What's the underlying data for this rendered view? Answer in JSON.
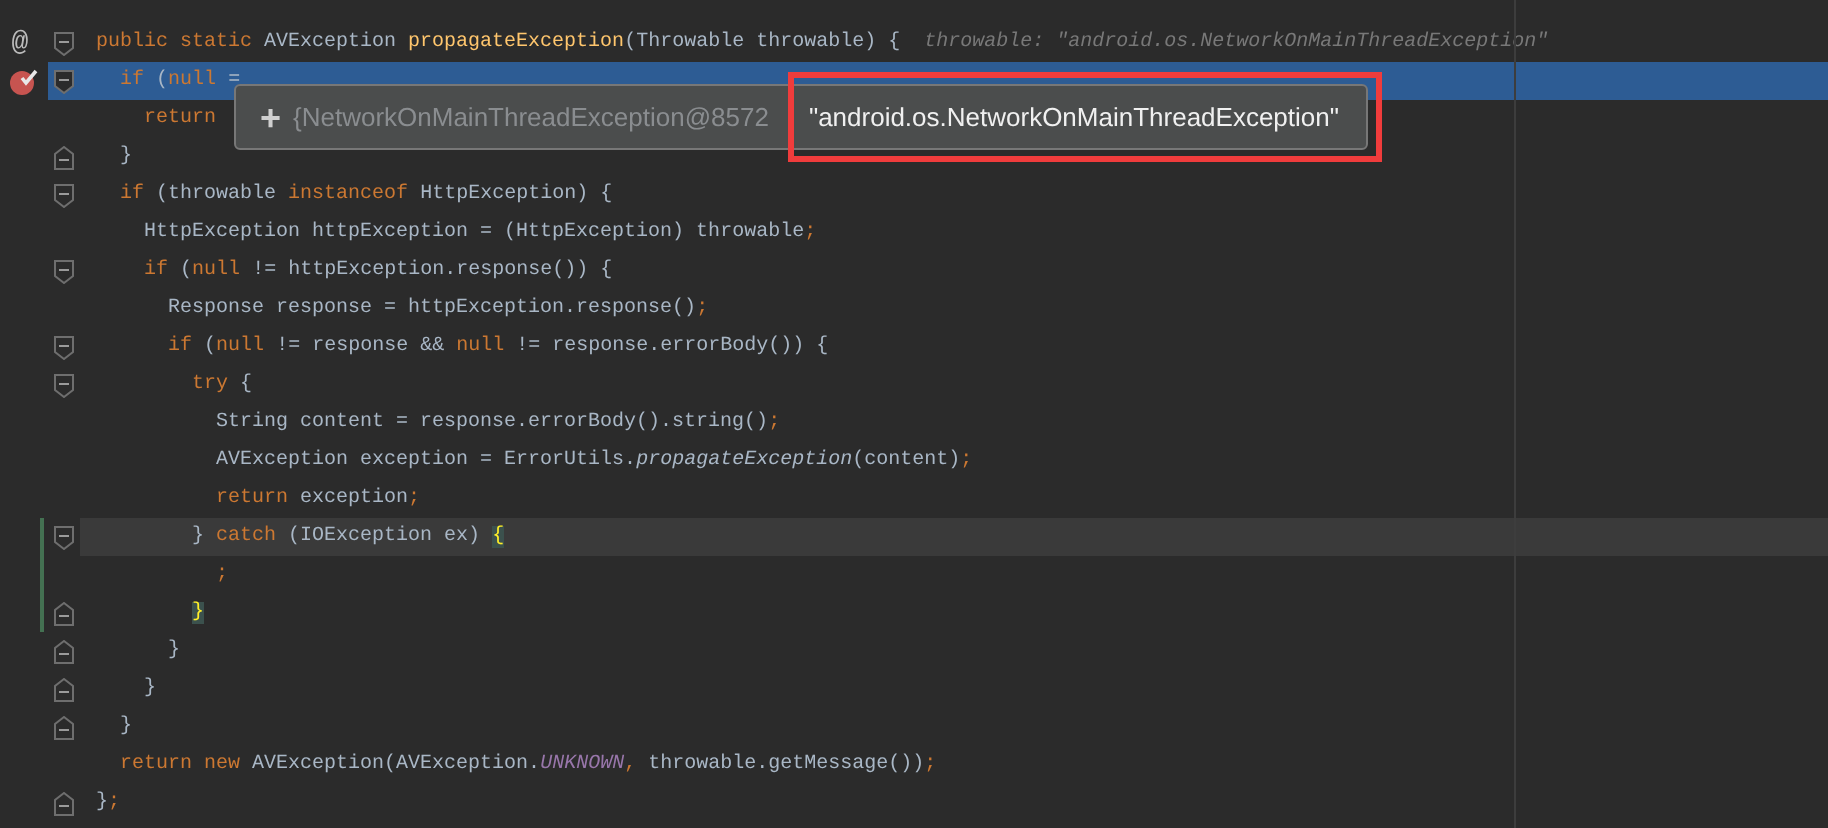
{
  "editor": {
    "lines": [
      {
        "gutter_mark": "@",
        "breakpoint": false,
        "fold_start": true,
        "fold_end": false,
        "highlighted": false,
        "caret_line": false,
        "changed": false,
        "segments": [
          {
            "kind": "keyword",
            "text": "public static "
          },
          {
            "kind": "plain",
            "text": "AVException "
          },
          {
            "kind": "method",
            "text": "propagateException"
          },
          {
            "kind": "plain",
            "text": "(Throwable throwable) {  "
          },
          {
            "kind": "hint",
            "text": "throwable: \"android.os.NetworkOnMainThreadException\""
          }
        ]
      },
      {
        "breakpoint": true,
        "fold_start": true,
        "fold_end": false,
        "highlighted": true,
        "caret_line": false,
        "changed": false,
        "segments": [
          {
            "kind": "keyword",
            "text": "  if "
          },
          {
            "kind": "plain",
            "text": "("
          },
          {
            "kind": "keyword",
            "text": "null"
          },
          {
            "kind": "plain",
            "text": " ="
          }
        ]
      },
      {
        "breakpoint": false,
        "fold_start": false,
        "fold_end": false,
        "highlighted": false,
        "caret_line": false,
        "changed": false,
        "segments": [
          {
            "kind": "keyword",
            "text": "    return"
          }
        ]
      },
      {
        "breakpoint": false,
        "fold_start": false,
        "fold_end": true,
        "highlighted": false,
        "caret_line": false,
        "changed": false,
        "segments": [
          {
            "kind": "plain",
            "text": "  }"
          }
        ]
      },
      {
        "breakpoint": false,
        "fold_start": true,
        "fold_end": false,
        "highlighted": false,
        "caret_line": false,
        "changed": false,
        "segments": [
          {
            "kind": "keyword",
            "text": "  if "
          },
          {
            "kind": "plain",
            "text": "(throwable "
          },
          {
            "kind": "keyword",
            "text": "instanceof "
          },
          {
            "kind": "plain",
            "text": "HttpException) {"
          }
        ]
      },
      {
        "breakpoint": false,
        "fold_start": false,
        "fold_end": false,
        "highlighted": false,
        "caret_line": false,
        "changed": false,
        "segments": [
          {
            "kind": "plain",
            "text": "    HttpException httpException = (HttpException) throwable"
          },
          {
            "kind": "keyword",
            "text": ";"
          }
        ]
      },
      {
        "breakpoint": false,
        "fold_start": true,
        "fold_end": false,
        "highlighted": false,
        "caret_line": false,
        "changed": false,
        "segments": [
          {
            "kind": "keyword",
            "text": "    if "
          },
          {
            "kind": "plain",
            "text": "("
          },
          {
            "kind": "keyword",
            "text": "null "
          },
          {
            "kind": "plain",
            "text": "!= httpException.response()) {"
          }
        ]
      },
      {
        "breakpoint": false,
        "fold_start": false,
        "fold_end": false,
        "highlighted": false,
        "caret_line": false,
        "changed": false,
        "segments": [
          {
            "kind": "plain",
            "text": "      Response response = httpException.response()"
          },
          {
            "kind": "keyword",
            "text": ";"
          }
        ]
      },
      {
        "breakpoint": false,
        "fold_start": true,
        "fold_end": false,
        "highlighted": false,
        "caret_line": false,
        "changed": false,
        "segments": [
          {
            "kind": "keyword",
            "text": "      if "
          },
          {
            "kind": "plain",
            "text": "("
          },
          {
            "kind": "keyword",
            "text": "null "
          },
          {
            "kind": "plain",
            "text": "!= response && "
          },
          {
            "kind": "keyword",
            "text": "null "
          },
          {
            "kind": "plain",
            "text": "!= response.errorBody()) {"
          }
        ]
      },
      {
        "breakpoint": false,
        "fold_start": true,
        "fold_end": false,
        "highlighted": false,
        "caret_line": false,
        "changed": false,
        "segments": [
          {
            "kind": "keyword",
            "text": "        try "
          },
          {
            "kind": "plain",
            "text": "{"
          }
        ]
      },
      {
        "breakpoint": false,
        "fold_start": false,
        "fold_end": false,
        "highlighted": false,
        "caret_line": false,
        "changed": false,
        "segments": [
          {
            "kind": "plain",
            "text": "          String content = response.errorBody().string()"
          },
          {
            "kind": "keyword",
            "text": ";"
          }
        ]
      },
      {
        "breakpoint": false,
        "fold_start": false,
        "fold_end": false,
        "highlighted": false,
        "caret_line": false,
        "changed": false,
        "segments": [
          {
            "kind": "plain",
            "text": "          AVException exception = ErrorUtils."
          },
          {
            "kind": "static",
            "text": "propagateException"
          },
          {
            "kind": "plain",
            "text": "(content)"
          },
          {
            "kind": "keyword",
            "text": ";"
          }
        ]
      },
      {
        "breakpoint": false,
        "fold_start": false,
        "fold_end": false,
        "highlighted": false,
        "caret_line": false,
        "changed": false,
        "segments": [
          {
            "kind": "keyword",
            "text": "          return "
          },
          {
            "kind": "plain",
            "text": "exception"
          },
          {
            "kind": "keyword",
            "text": ";"
          }
        ]
      },
      {
        "breakpoint": false,
        "fold_start": true,
        "fold_end": false,
        "highlighted": false,
        "caret_line": true,
        "changed": true,
        "segments": [
          {
            "kind": "plain",
            "text": "        } "
          },
          {
            "kind": "keyword",
            "text": "catch "
          },
          {
            "kind": "plain",
            "text": "(IOException ex) "
          },
          {
            "kind": "brace",
            "text": "{"
          }
        ]
      },
      {
        "breakpoint": false,
        "fold_start": false,
        "fold_end": false,
        "highlighted": false,
        "caret_line": false,
        "changed": true,
        "segments": [
          {
            "kind": "keyword",
            "text": "          ;"
          }
        ]
      },
      {
        "breakpoint": false,
        "fold_start": false,
        "fold_end": true,
        "highlighted": false,
        "caret_line": false,
        "changed": true,
        "segments": [
          {
            "kind": "brace",
            "text": "        }"
          }
        ]
      },
      {
        "breakpoint": false,
        "fold_start": false,
        "fold_end": true,
        "highlighted": false,
        "caret_line": false,
        "changed": false,
        "segments": [
          {
            "kind": "plain",
            "text": "      }"
          }
        ]
      },
      {
        "breakpoint": false,
        "fold_start": false,
        "fold_end": true,
        "highlighted": false,
        "caret_line": false,
        "changed": false,
        "segments": [
          {
            "kind": "plain",
            "text": "    }"
          }
        ]
      },
      {
        "breakpoint": false,
        "fold_start": false,
        "fold_end": true,
        "highlighted": false,
        "caret_line": false,
        "changed": false,
        "segments": [
          {
            "kind": "plain",
            "text": "  }"
          }
        ]
      },
      {
        "breakpoint": false,
        "fold_start": false,
        "fold_end": false,
        "highlighted": false,
        "caret_line": false,
        "changed": false,
        "segments": [
          {
            "kind": "keyword",
            "text": "  return new "
          },
          {
            "kind": "plain",
            "text": "AVException(AVException."
          },
          {
            "kind": "constant",
            "text": "UNKNOWN"
          },
          {
            "kind": "keyword",
            "text": ", "
          },
          {
            "kind": "plain",
            "text": "throwable.getMessage())"
          },
          {
            "kind": "keyword",
            "text": ";"
          }
        ]
      },
      {
        "breakpoint": false,
        "fold_start": false,
        "fold_end": true,
        "highlighted": false,
        "caret_line": false,
        "changed": false,
        "segments": [
          {
            "kind": "plain",
            "text": "}"
          },
          {
            "kind": "keyword",
            "text": ";"
          }
        ]
      }
    ]
  },
  "tooltip": {
    "expand": "+",
    "object": "{NetworkOnMainThreadException@8572",
    "value": "\"android.os.NetworkOnMainThreadException\"",
    "annotated": true
  }
}
